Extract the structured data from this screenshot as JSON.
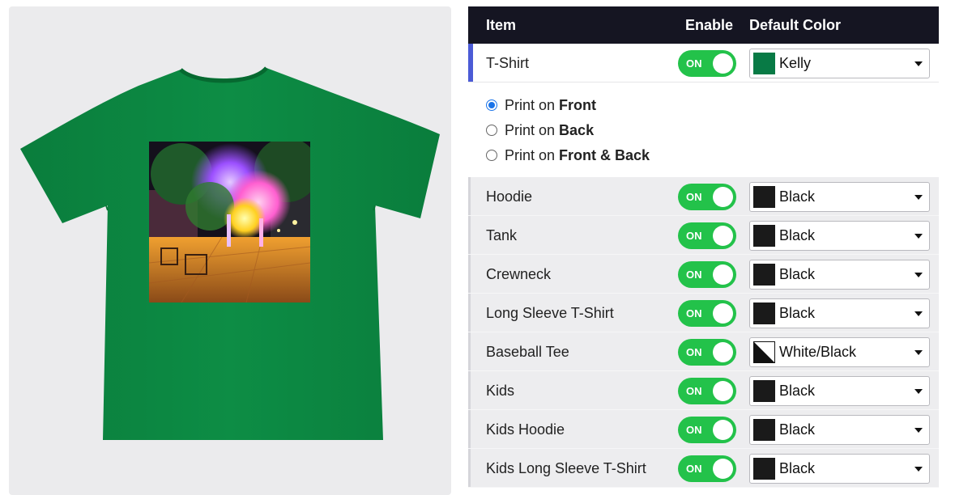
{
  "colors": {
    "header_bg": "#151522",
    "toggle_on": "#23c24a",
    "accent_selected": "#4b5bd6",
    "shirt_kelly": "#0b8a42"
  },
  "preview": {
    "product": "t-shirt",
    "shirt_color": "#0b8a42"
  },
  "table": {
    "header": {
      "item": "Item",
      "enable": "Enable",
      "default_color": "Default Color"
    },
    "first_row": {
      "label": "T-Shirt",
      "toggle": "ON",
      "color": "Kelly",
      "swatch": "#087a45"
    },
    "print_options": [
      {
        "prefix": "Print on ",
        "strong": "Front",
        "selected": true
      },
      {
        "prefix": "Print on ",
        "strong": "Back",
        "selected": false
      },
      {
        "prefix": "Print on ",
        "strong": "Front & Back",
        "selected": false
      }
    ],
    "rows": [
      {
        "label": "Hoodie",
        "toggle": "ON",
        "color": "Black",
        "swatch": "#1a1a1a"
      },
      {
        "label": "Tank",
        "toggle": "ON",
        "color": "Black",
        "swatch": "#1a1a1a"
      },
      {
        "label": "Crewneck",
        "toggle": "ON",
        "color": "Black",
        "swatch": "#1a1a1a"
      },
      {
        "label": "Long Sleeve T-Shirt",
        "toggle": "ON",
        "color": "Black",
        "swatch": "#1a1a1a"
      },
      {
        "label": "Baseball Tee",
        "toggle": "ON",
        "color": "White/Black",
        "swatch": "white-black-diagonal"
      },
      {
        "label": "Kids",
        "toggle": "ON",
        "color": "Black",
        "swatch": "#1a1a1a"
      },
      {
        "label": "Kids Hoodie",
        "toggle": "ON",
        "color": "Black",
        "swatch": "#1a1a1a"
      },
      {
        "label": "Kids Long Sleeve T-Shirt",
        "toggle": "ON",
        "color": "Black",
        "swatch": "#1a1a1a"
      }
    ]
  }
}
